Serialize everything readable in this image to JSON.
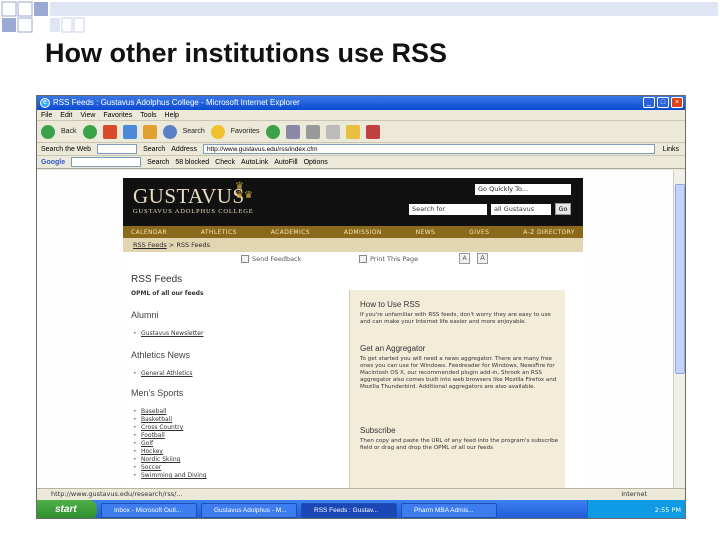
{
  "slide": {
    "title": "How other institutions use RSS",
    "accent_color": "#b9c7e6"
  },
  "browser": {
    "window_title": "RSS Feeds : Gustavus Adolphus College - Microsoft Internet Explorer",
    "menu": [
      "File",
      "Edit",
      "View",
      "Favorites",
      "Tools",
      "Help"
    ],
    "toolbar": {
      "back": "Back",
      "search": "Search",
      "favorites": "Favorites"
    },
    "search_the_web": "Search the Web",
    "search_btn": "Search",
    "address_label": "Address",
    "address": "http://www.gustavus.edu/rss/index.cfm",
    "links_label": "Links",
    "google": {
      "logo": "Google",
      "search": "Search",
      "blocked": "58 blocked",
      "check": "Check",
      "autolink": "AutoLink",
      "autofill": "AutoFill",
      "options": "Options"
    },
    "status": {
      "url": "http://www.gustavus.edu/research/rss/...",
      "zone": "Internet"
    }
  },
  "site": {
    "logo": "GUSTAVUS",
    "logo_sub": "GUSTAVUS ADOLPHUS COLLEGE",
    "quick_select": "Go Quickly To...",
    "search_field": "Search for",
    "scope": "all Gustavus",
    "go": "Go",
    "nav": [
      "CALENDAR",
      "ATHLETICS",
      "ACADEMICS",
      "ADMISSION",
      "NEWS",
      "GIVES",
      "A-Z DIRECTORY"
    ],
    "breadcrumb_link": "RSS Feeds",
    "breadcrumb_current": " > RSS Feeds",
    "send_feedback": "Send Feedback",
    "print_page": "Print This Page",
    "font_smaller": "A",
    "font_larger": "A",
    "page_title": "RSS Feeds",
    "opml_all": "OPML of all our feeds",
    "alumni": {
      "head": "Alumni",
      "items": [
        "Gustavus Newsletter"
      ]
    },
    "athletics": {
      "head": "Athletics News",
      "items": [
        "General Athletics"
      ]
    },
    "mens_sports": {
      "head": "Men's Sports",
      "items": [
        "Baseball",
        "Basketball",
        "Cross Country",
        "Football",
        "Golf",
        "Hockey",
        "Nordic Skiing",
        "Soccer",
        "Swimming and Diving"
      ]
    },
    "howto": {
      "head": "How to Use RSS",
      "text": "If you're unfamiliar with RSS feeds, don't worry they are easy to use and can make your Internet life easier and more enjoyable.",
      "aggregator_head": "Get an Aggregator",
      "aggregator_text": "To get started you will need a news aggregator. There are many free ones you can use for Windows. Feedreader for Windows, NewsFire for Macintosh OS X, our recommended plugin add-in, Shrook an RSS aggregator also comes built into web browsers like Mozilla Firefox and Mozilla Thunderbird. Additional aggregators are also available.",
      "subscribe_head": "Subscribe",
      "subscribe_text": "Then copy and paste the URL of any feed into the program's subscribe field or drag and drop the OPML of all our feeds"
    }
  },
  "taskbar": {
    "start": "start",
    "tasks": [
      "Inbox - Microsoft Outl...",
      "Gustavus Adolphus - M...",
      "RSS Feeds : Gustav...",
      "Pharm MBA Admis..."
    ],
    "clock": "2:55 PM"
  }
}
